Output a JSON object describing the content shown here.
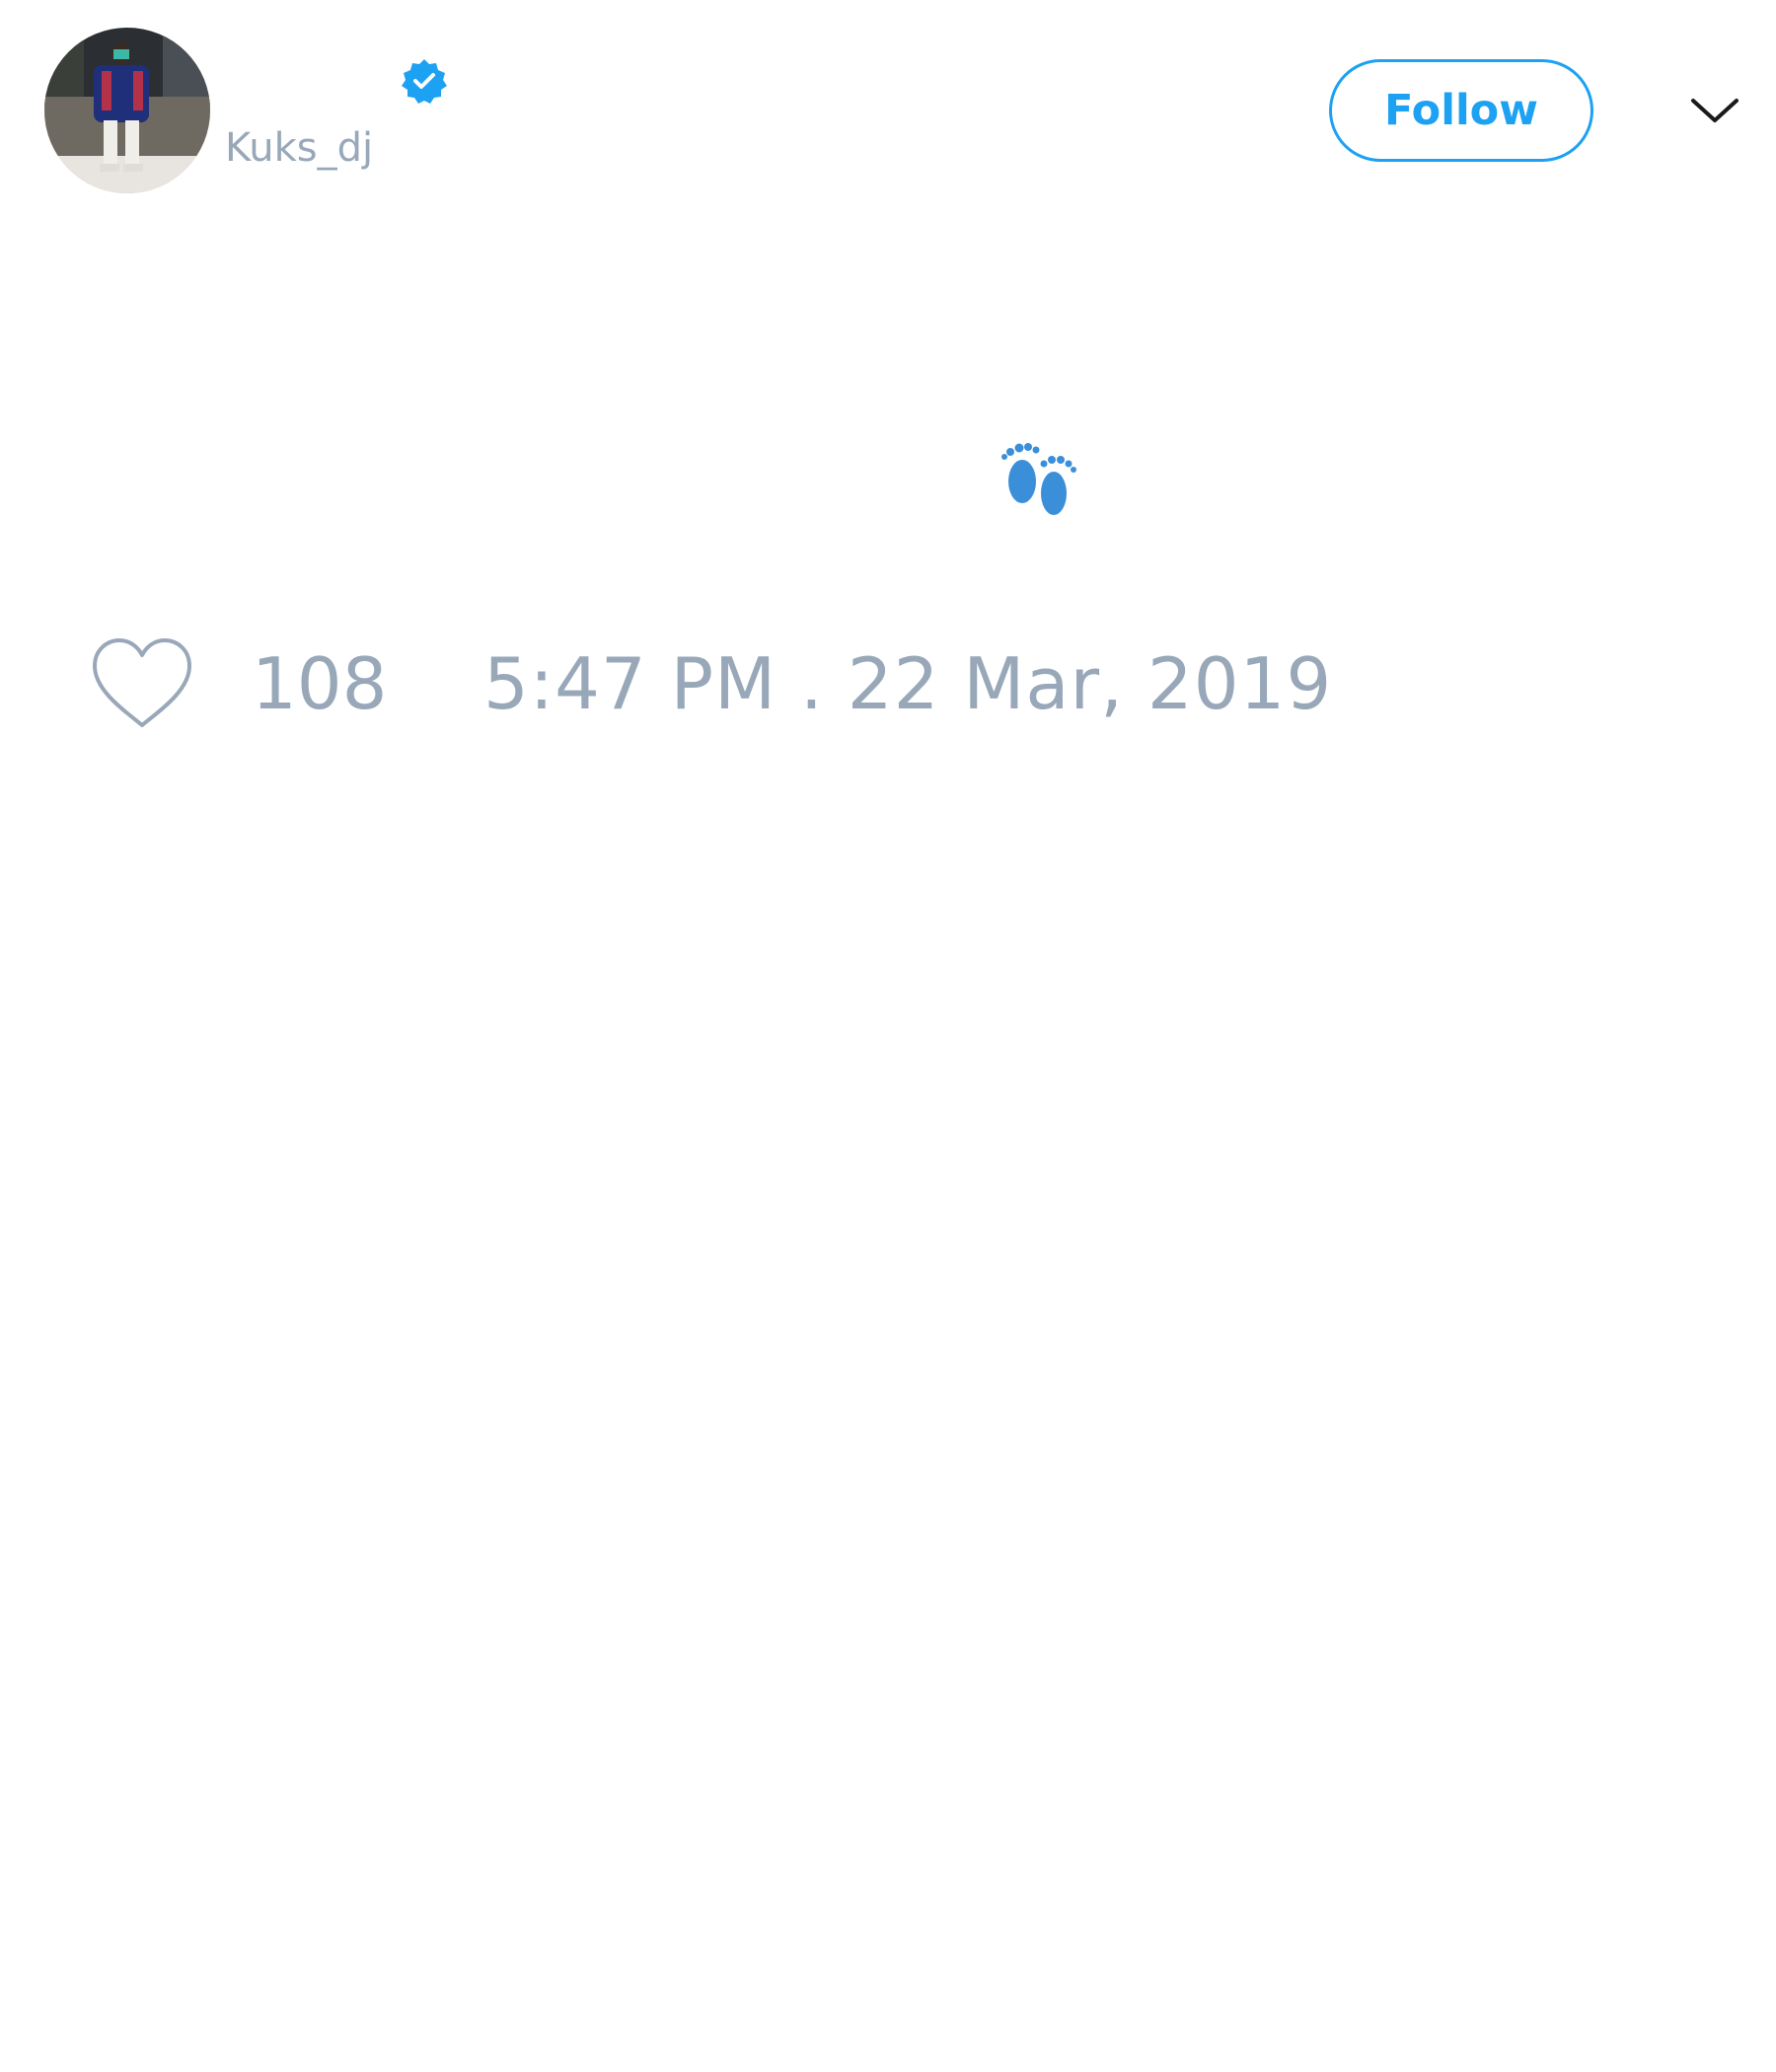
{
  "author": {
    "display_name": "",
    "handle": "Kuks_dj",
    "verified": true,
    "avatar_icon": "profile-photo"
  },
  "header": {
    "follow_label": "Follow",
    "menu_icon": "chevron-down-icon"
  },
  "tweet": {
    "body_icon": "footprints-emoji"
  },
  "footer": {
    "like_icon": "heart-outline-icon",
    "like_count": "108",
    "timestamp": "5:47 PM . 22 Mar, 2019"
  },
  "colors": {
    "accent": "#1da1f2",
    "muted_text": "#98a8b9",
    "background": "#ffffff"
  }
}
